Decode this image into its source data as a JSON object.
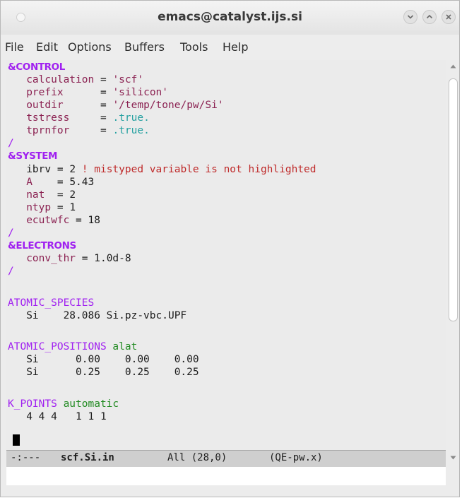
{
  "window": {
    "title": "emacs@catalyst.ijs.si"
  },
  "menu": {
    "items": [
      "File",
      "Edit",
      "Options",
      "Buffers",
      "Tools",
      "Help"
    ]
  },
  "editor": {
    "control": {
      "header": "&CONTROL",
      "calculation": {
        "name": "calculation",
        "op": " = ",
        "value": "'scf'"
      },
      "prefix": {
        "name": "prefix     ",
        "op": " = ",
        "value": "'silicon'"
      },
      "outdir": {
        "name": "outdir     ",
        "op": " = ",
        "value": "'/temp/tone/pw/Si'"
      },
      "tstress": {
        "name": "tstress    ",
        "op": " = ",
        "value": ".true."
      },
      "tprnfor": {
        "name": "tprnfor    ",
        "op": " = ",
        "value": ".true."
      }
    },
    "slash": "/",
    "system": {
      "header": "&SYSTEM",
      "ibrv": {
        "name": "ibrv",
        "op": " = 2 ",
        "comment": "! mistyped variable is not highlighted"
      },
      "A": {
        "name": "A   ",
        "op": " = 5.43"
      },
      "nat": {
        "name": "nat ",
        "op": " = 2"
      },
      "ntyp": {
        "name": "ntyp",
        "op": " = 1"
      },
      "ecutwfc": {
        "name": "ecutwfc",
        "op": " = 18"
      }
    },
    "electrons": {
      "header": "&ELECTRONS",
      "conv_thr": {
        "name": "conv_thr",
        "op": " = 1.0d-8"
      }
    },
    "atomic_species": {
      "header": "ATOMIC_SPECIES",
      "row": "   Si    28.086 Si.pz-vbc.UPF"
    },
    "atomic_positions": {
      "header": "ATOMIC_POSITIONS",
      "option": "alat",
      "rows": [
        "   Si      0.00    0.00    0.00",
        "   Si      0.25    0.25    0.25"
      ]
    },
    "k_points": {
      "header": "K_POINTS",
      "option": "automatic",
      "row": "   4 4 4   1 1 1"
    }
  },
  "modeline": {
    "status": "-:---",
    "buffer": "scf.Si.in",
    "position": "All (28,0)",
    "mode": "(QE-pw.x)"
  },
  "colors": {
    "section": "#a020f0",
    "keyword": "#8b2252",
    "string": "#8b2252",
    "boolean": "#26a1a1",
    "comment_warning": "#bf2a2a",
    "option": "#228b22"
  }
}
